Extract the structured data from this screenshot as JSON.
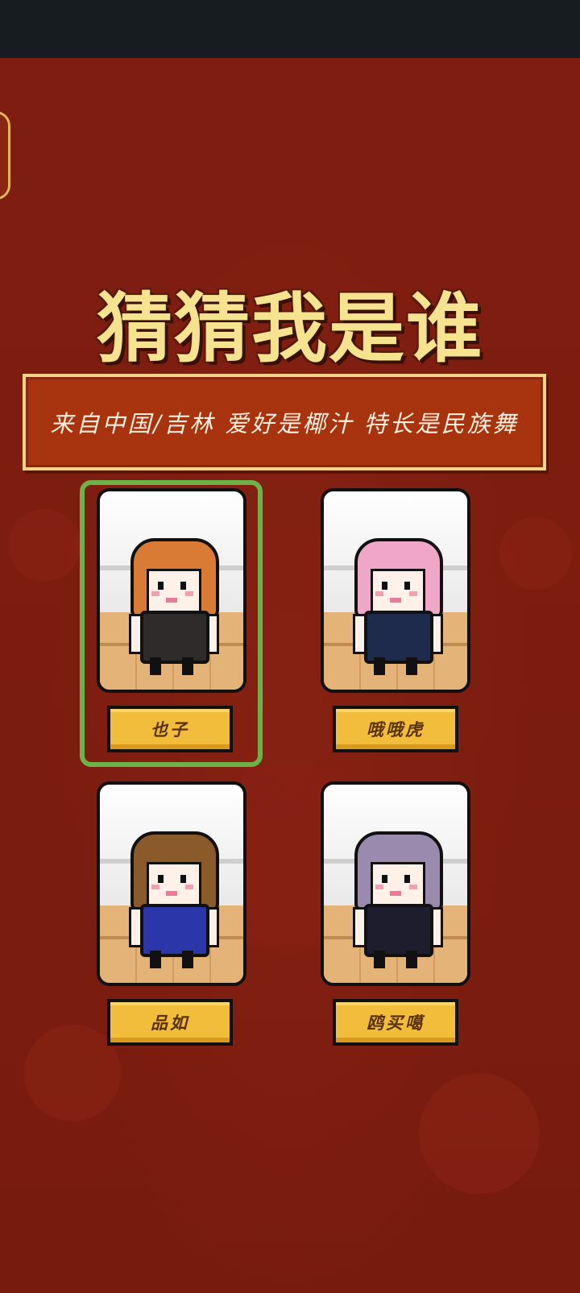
{
  "title": "猜猜我是谁",
  "clue": "来自中国/吉林 爱好是椰汁 特长是民族舞",
  "selected_index": 0,
  "characters": [
    {
      "name": "也子",
      "hair_color": "#d97b35",
      "outfit_color": "#2e2b2a",
      "icon": "brown-hair-character-icon"
    },
    {
      "name": "哦哦虎",
      "hair_color": "#f0a6c6",
      "outfit_color": "#1f2b4d",
      "icon": "pink-hair-character-icon"
    },
    {
      "name": "品如",
      "hair_color": "#8b5a2b",
      "outfit_color": "#2b36a8",
      "icon": "short-brown-hair-character-icon"
    },
    {
      "name": "鸥买噶",
      "hair_color": "#9a8aae",
      "outfit_color": "#1e1d2e",
      "icon": "lavender-hair-character-icon"
    }
  ],
  "colors": {
    "background": "#7d1d10",
    "title": "#f6e38f",
    "banner": "#a8330f",
    "selection": "#6cb248",
    "name_button": "#f3bd3c"
  }
}
